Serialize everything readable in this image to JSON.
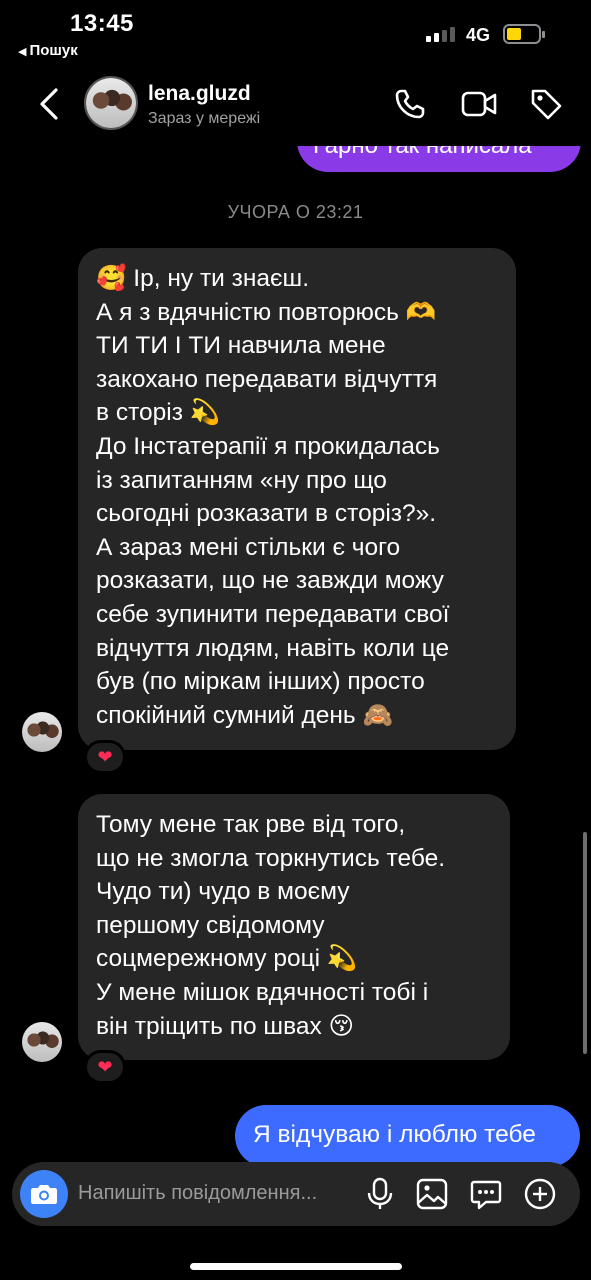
{
  "status_bar": {
    "time": "13:45",
    "back_app": "Пошук",
    "network": "4G"
  },
  "header": {
    "username": "lena.gluzd",
    "status": "Зараз у мережі",
    "icons": [
      "back-chevron-icon",
      "phone-icon",
      "video-camera-icon",
      "tag-icon"
    ]
  },
  "conversation": {
    "partial_outgoing": "Гарно так написала",
    "date_separator": "УЧОРА О 23:21",
    "incoming_1": {
      "lines": [
        "🥰 Ір, ну ти знаєш.",
        "А я з вдячністю повторюсь 🫶",
        "ТИ ТИ І ТИ навчила мене",
        "закохано передавати відчуття",
        "в сторіз 💫",
        "До Інстатерапії я прокидалась",
        "із запитанням «ну про що",
        "сьогодні розказати в сторіз?».",
        "А зараз мені стільки є чого",
        "розказати, що не завжди можу",
        "себе зупинити передавати свої",
        "відчуття людям, навіть коли це",
        "був (по міркам інших) просто",
        "спокійний сумний день 🙈"
      ],
      "reaction": "❤"
    },
    "incoming_2": {
      "lines": [
        "Тому мене так рве від того,",
        "що не змогла торкнутись тебе.",
        "Чудо ти) чудо в моєму",
        "першому свідомому",
        "соцмережному році 💫",
        "У мене мішок вдячності тобі і",
        "він тріщить по швах 😚"
      ],
      "reaction": "❤"
    },
    "outgoing_last": "Я відчуваю і люблю тебе"
  },
  "composer": {
    "placeholder": "Напишіть повідомлення...",
    "icons": [
      "camera-icon",
      "microphone-icon",
      "gallery-icon",
      "sticker-icon",
      "plus-icon"
    ]
  },
  "colors": {
    "outgoing_purple": "#8b3ae8",
    "outgoing_blue": "#3d6aff",
    "incoming_bubble": "#262626",
    "camera_button": "#3d82f6",
    "battery": "#ffd60a"
  }
}
